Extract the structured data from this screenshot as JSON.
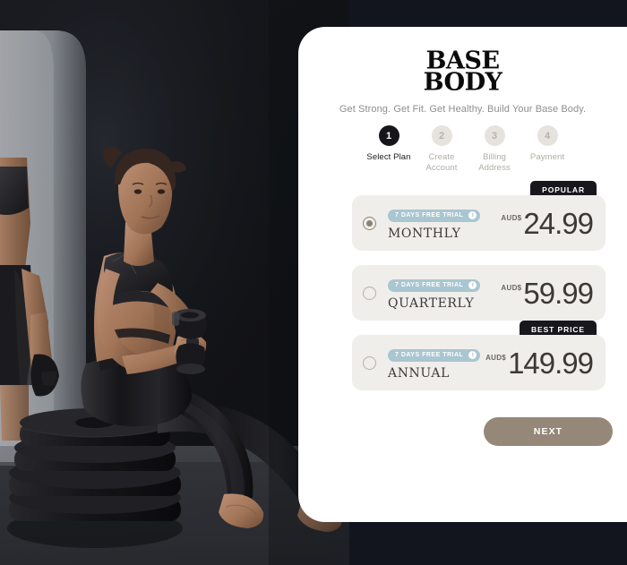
{
  "brand": {
    "logo_line1": "BASE",
    "logo_line2": "BODY",
    "tagline": "Get Strong. Get Fit. Get Healthy. Build Your Base Body."
  },
  "stepper": {
    "steps": [
      {
        "number": "1",
        "label": "Select Plan",
        "active": true
      },
      {
        "number": "2",
        "label": "Create Account",
        "active": false
      },
      {
        "number": "3",
        "label": "Billing Address",
        "active": false
      },
      {
        "number": "4",
        "label": "Payment",
        "active": false
      }
    ]
  },
  "plans": [
    {
      "ribbon": "POPULAR",
      "trial": "7 DAYS FREE TRIAL",
      "info": "i",
      "name": "MONTHLY",
      "currency": "AUD$",
      "price": "24.99",
      "selected": true
    },
    {
      "ribbon": "",
      "trial": "7 DAYS FREE TRIAL",
      "info": "i",
      "name": "QUARTERLY",
      "currency": "AUD$",
      "price": "59.99",
      "selected": false
    },
    {
      "ribbon": "BEST PRICE",
      "trial": "7 DAYS FREE TRIAL",
      "info": "i",
      "name": "ANNUAL",
      "currency": "AUD$",
      "price": "149.99",
      "selected": false
    }
  ],
  "actions": {
    "next_label": "NEXT"
  },
  "colors": {
    "background": "#12151d",
    "panel": "#ffffff",
    "card": "#f0eeeb",
    "accent_trial": "#a9c6d1",
    "ribbon": "#17171c",
    "next_button": "#958878",
    "radio_selected": "#8d8076"
  },
  "hero_image": {
    "alt": "Woman in black sportswear seated on stacked weight plates holding a dumbbell in a dark studio"
  }
}
